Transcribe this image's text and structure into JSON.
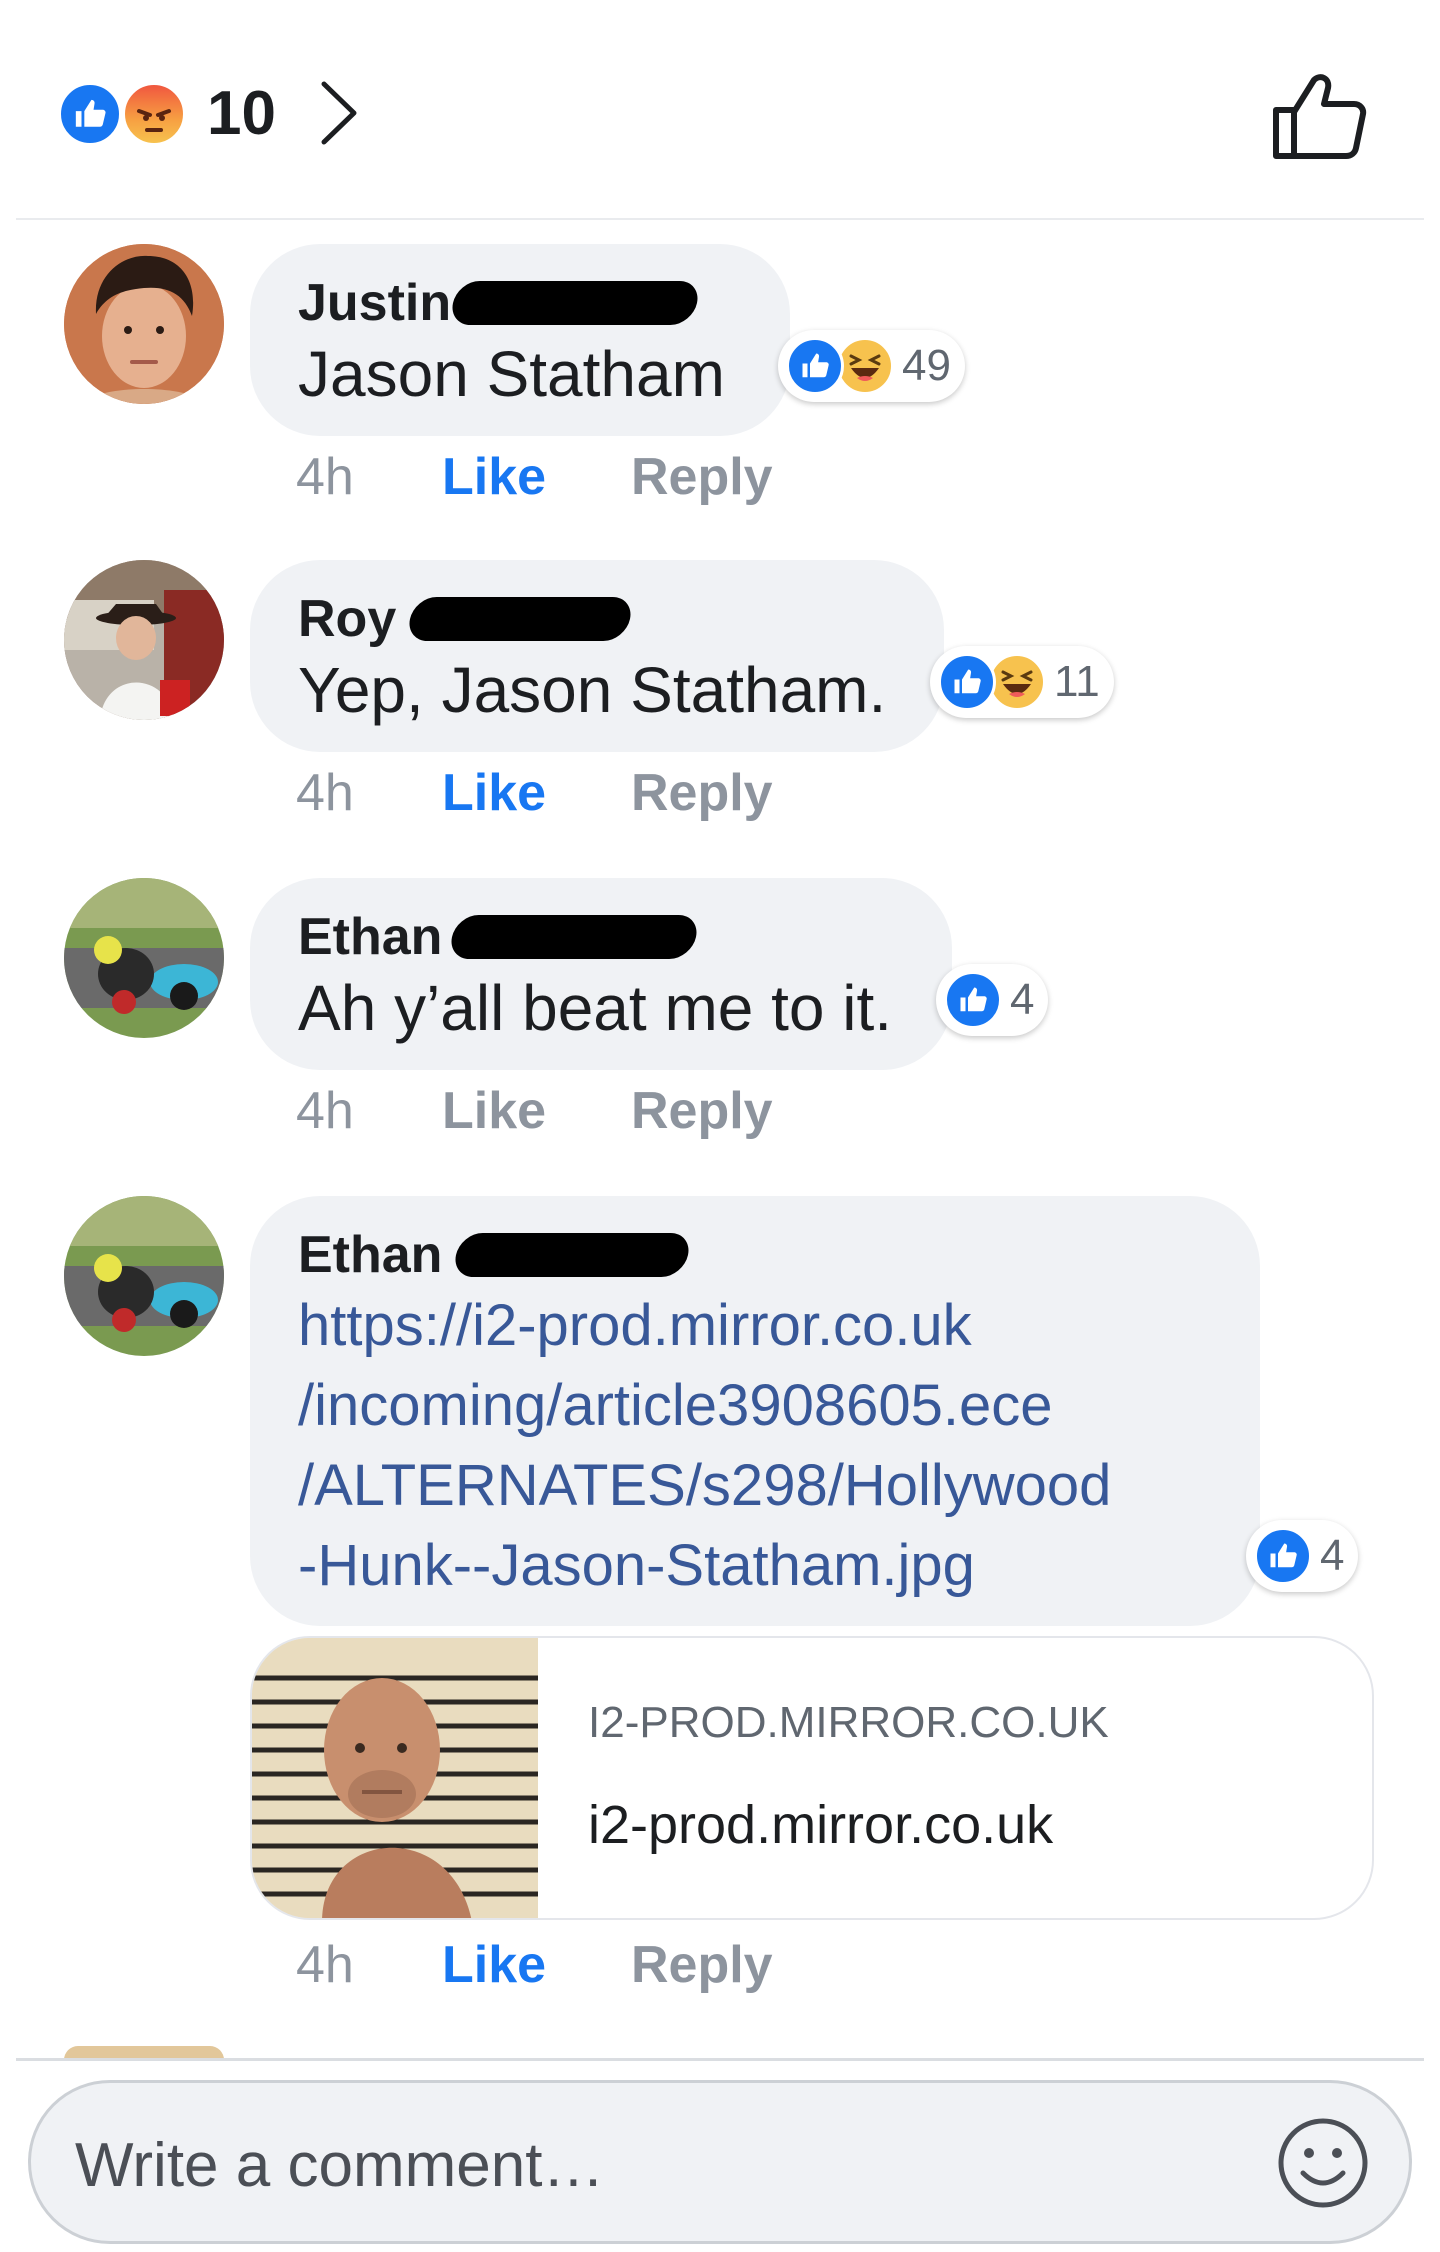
{
  "header": {
    "reaction_count": "10",
    "reactions": [
      "like-icon",
      "angry-icon"
    ]
  },
  "comments": [
    {
      "author": "Justin",
      "text": "Jason Statham",
      "reactions": [
        "like-icon",
        "haha-icon"
      ],
      "reaction_count": "49",
      "time": "4h",
      "like_label": "Like",
      "reply_label": "Reply",
      "liked": true
    },
    {
      "author": "Roy",
      "text": "Yep, Jason Statham.",
      "reactions": [
        "like-icon",
        "haha-icon"
      ],
      "reaction_count": "11",
      "time": "4h",
      "like_label": "Like",
      "reply_label": "Reply",
      "liked": true
    },
    {
      "author": "Ethan",
      "text": "Ah y’all beat me to it.",
      "reactions": [
        "like-icon"
      ],
      "reaction_count": "4",
      "time": "4h",
      "like_label": "Like",
      "reply_label": "Reply",
      "liked": false
    },
    {
      "author": "Ethan",
      "link_lines": [
        "https://i2-prod.mirror.co.uk",
        "/incoming/article3908605.ece",
        "/ALTERNATES/s298/Hollywood",
        "-Hunk--Jason-Statham.jpg"
      ],
      "reactions": [
        "like-icon"
      ],
      "reaction_count": "4",
      "preview": {
        "domain_caps": "I2-PROD.MIRROR.CO.UK",
        "domain": "i2-prod.mirror.co.uk"
      },
      "time": "4h",
      "like_label": "Like",
      "reply_label": "Reply",
      "liked": true
    }
  ],
  "composer": {
    "placeholder": "Write a comment…",
    "value": ""
  },
  "colors": {
    "accent": "#1877f2",
    "bubble": "#f0f2f5",
    "link": "#385898",
    "muted": "#8d949e"
  }
}
